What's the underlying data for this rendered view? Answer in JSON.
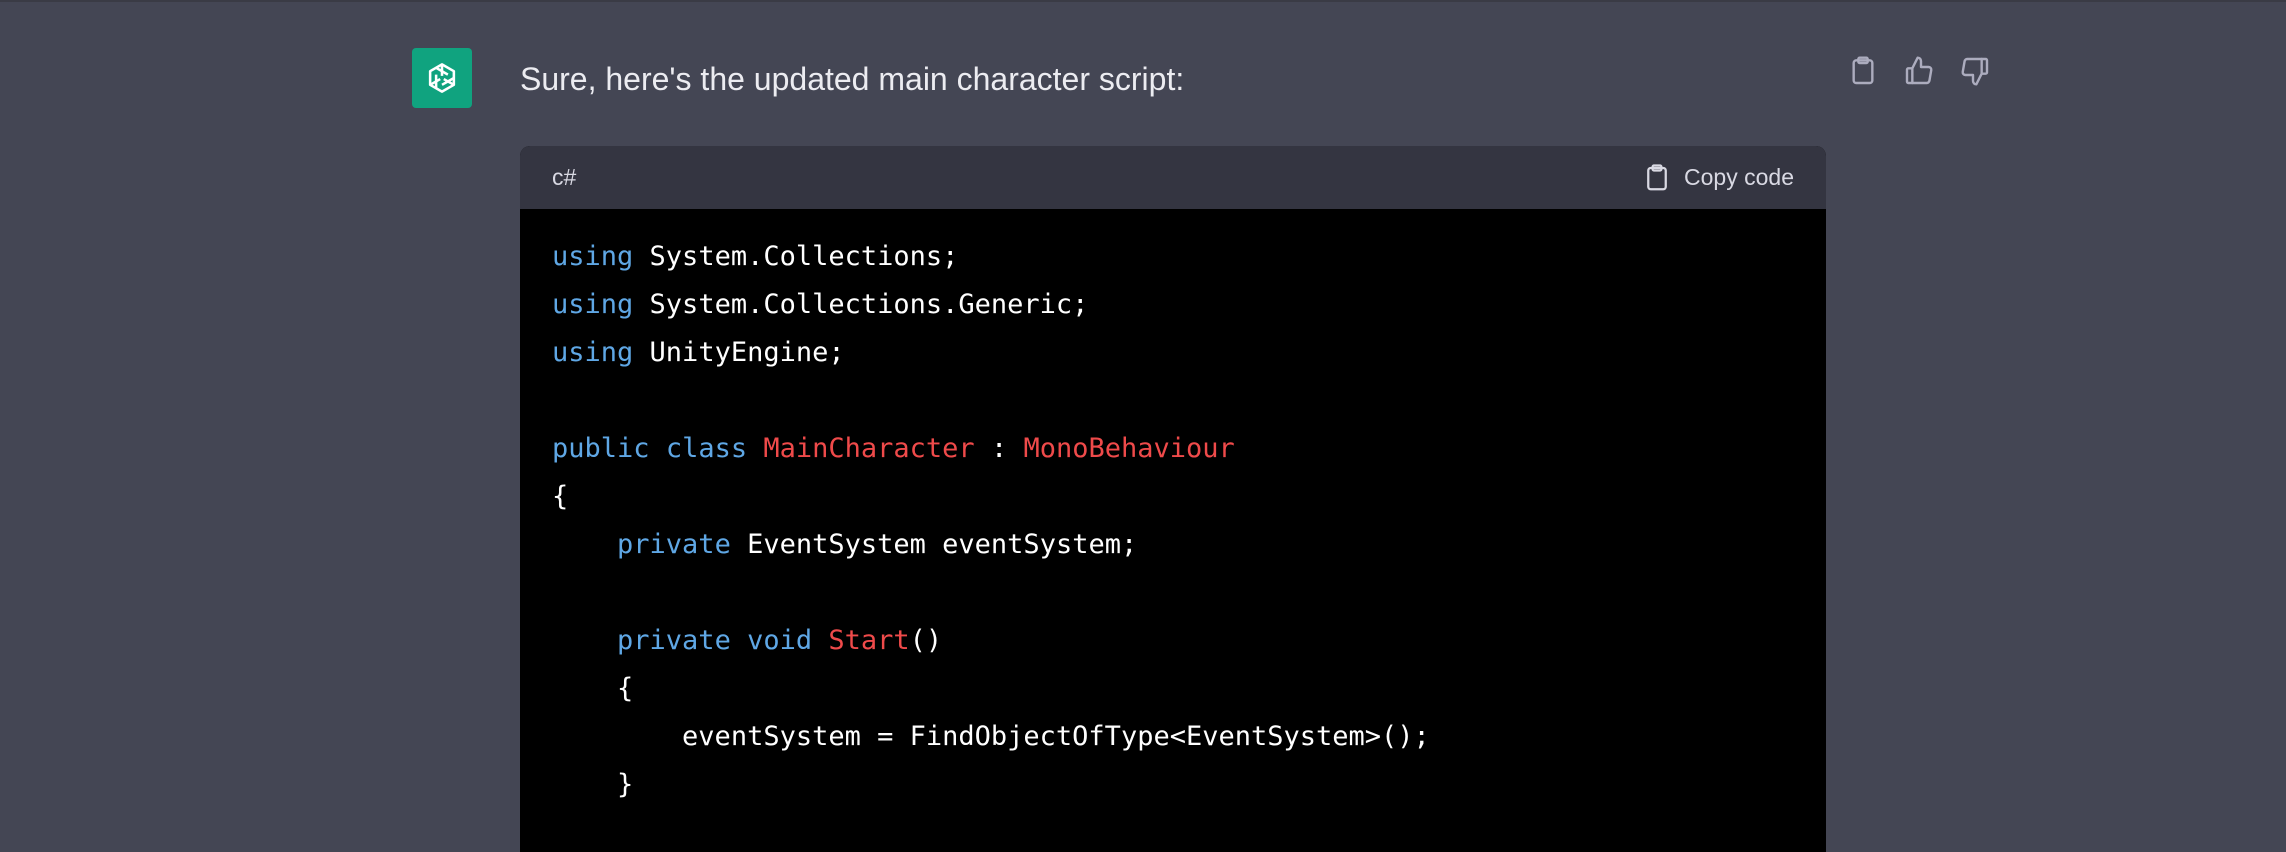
{
  "message": {
    "text": "Sure, here's the updated main character script:"
  },
  "actions": {
    "copy_icon": "clipboard-icon",
    "like_icon": "thumbs-up-icon",
    "dislike_icon": "thumbs-down-icon"
  },
  "code": {
    "language": "c#",
    "copy_label": "Copy code",
    "tokens": {
      "using": "using",
      "ns1": "System.Collections;",
      "ns2": "System.Collections.Generic;",
      "ns3": "UnityEngine;",
      "public": "public",
      "class": "class",
      "class_name": "MainCharacter",
      "colon": ":",
      "base_class": "MonoBehaviour",
      "open_brace": "{",
      "private": "private",
      "field_decl": "EventSystem eventSystem;",
      "void": "void",
      "method_name": "Start",
      "parens": "()",
      "assign_stmt": "eventSystem = FindObjectOfType<EventSystem>();",
      "close_brace": "}"
    }
  },
  "colors": {
    "background": "#444654",
    "avatar": "#10a37f",
    "keyword": "#5fa7e5",
    "type_name": "#ef4a4a",
    "code_bg": "#000000",
    "code_header_bg": "#343541"
  }
}
